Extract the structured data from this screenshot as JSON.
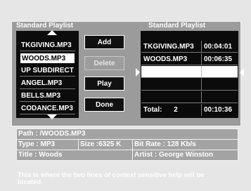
{
  "left_panel": {
    "title": "Standard Playlist",
    "items": [
      "TKGIVING.MP3",
      "WOODS.MP3",
      "UP SUBDIRECT",
      "ANGEL.MP3",
      "BELLS.MP3",
      "CODANCE.MP3"
    ],
    "selected_index": 1
  },
  "buttons": {
    "add": "Add",
    "delete": "Delete",
    "play": "Play",
    "done": "Done"
  },
  "right_panel": {
    "title": "Standard Playlist",
    "rows": [
      {
        "name": "TKGIVING.MP3",
        "duration": "00:04:01"
      },
      {
        "name": "WOODS.MP3",
        "duration": "00:06:35"
      }
    ],
    "total_label": "Total:",
    "total_count": "2",
    "total_duration": "00:10:36"
  },
  "info": {
    "path": "Path : /WOODS.MP3",
    "type": "Type : MP3",
    "size": "Size :6325 K",
    "bitrate": "Bit Rate : 128 Kb/s",
    "title": "Title : Woods",
    "artist": "Artist : George Winston"
  },
  "help_text": "This is where the two lines of context sensitive help will be located.",
  "colors": {
    "background": "#e6e6e6",
    "panel": "#9b9b9b",
    "list_bg": "#0c0c0c",
    "highlight": "#ffffff"
  },
  "icons": [
    "scroll-up-arrow-icon",
    "scroll-down-arrow-icon",
    "insert-left-arrow-icon",
    "insert-right-arrow-icon"
  ]
}
